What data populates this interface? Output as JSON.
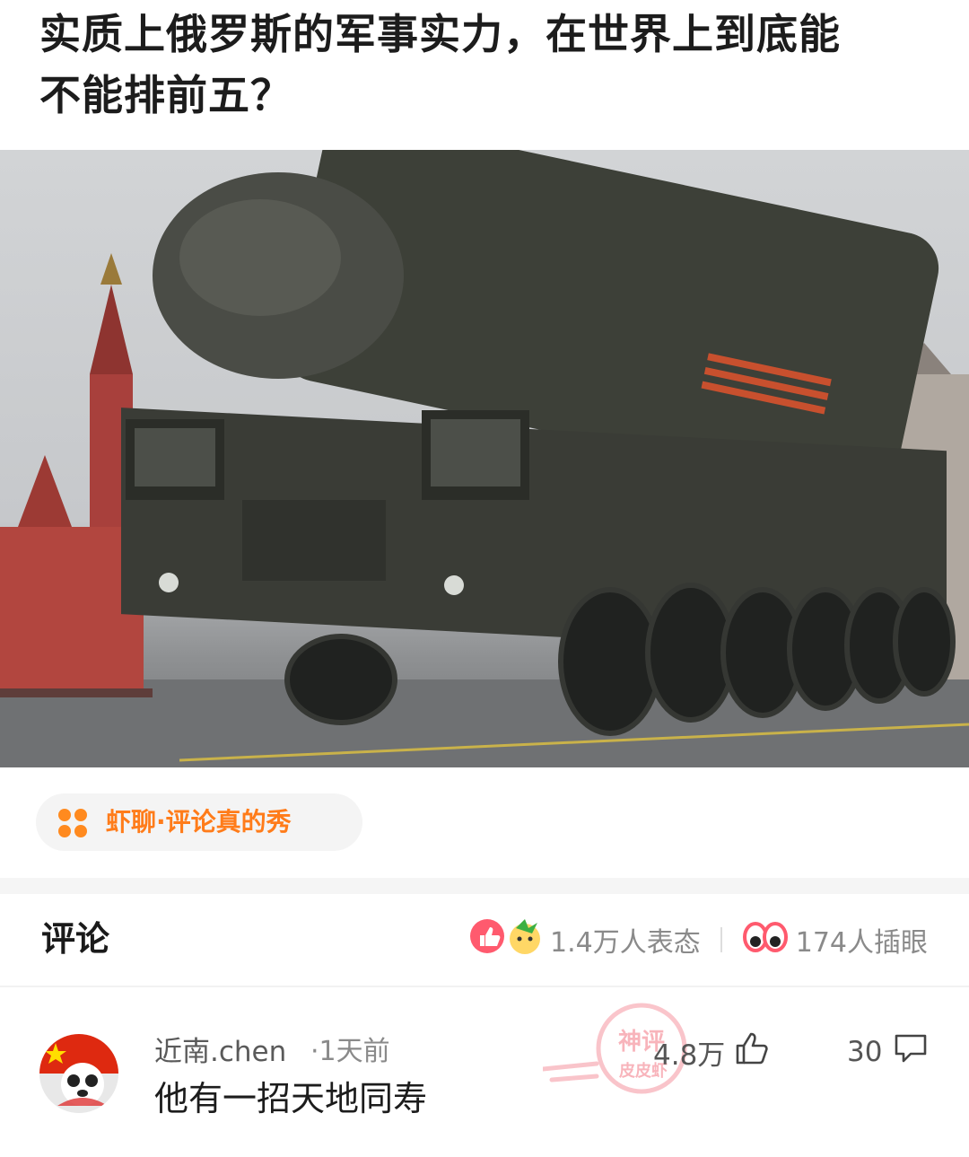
{
  "post": {
    "title_line1": "实质上俄罗斯的军事实力，在世界上到底能",
    "title_line2": "不能排前五？",
    "image_alt": "missile-launcher-truck-photo"
  },
  "topic": {
    "label": "虾聊·评论真的秀",
    "icon": "four-dots-icon",
    "color": "#ff7c1a"
  },
  "comments_header": {
    "title": "评论",
    "reactions": "1.4万人表态",
    "views": "174人插眼"
  },
  "comment": {
    "username": "近南.chen",
    "time": "·1天前",
    "text": "他有一招天地同寿",
    "likes": "4.8万",
    "replies": "30",
    "stamp_top": "神评",
    "stamp_bottom": "皮皮虾"
  }
}
